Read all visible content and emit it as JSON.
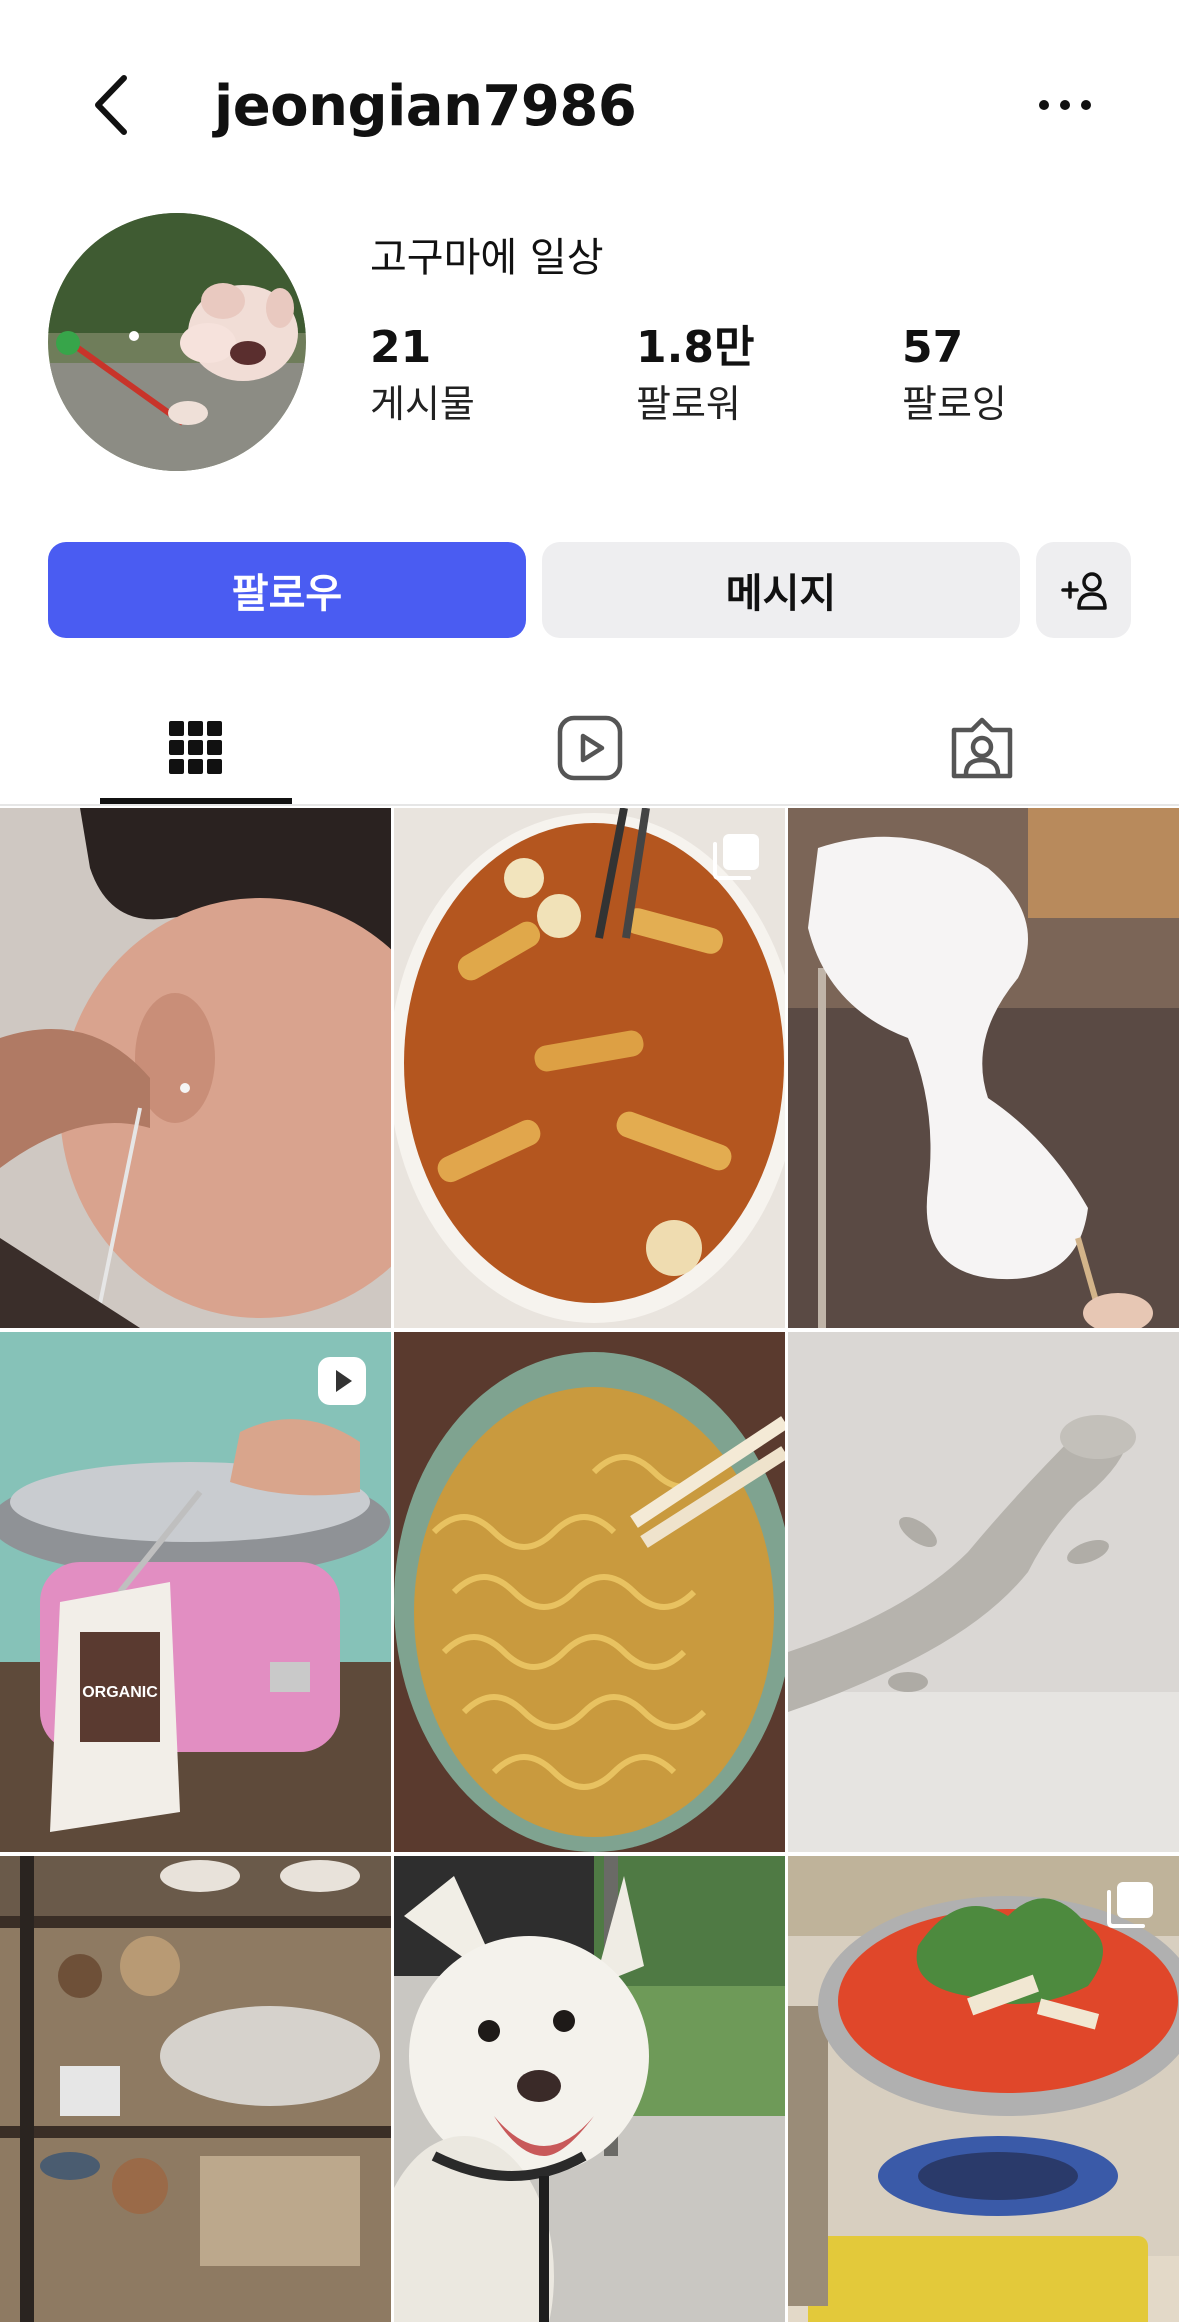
{
  "header": {
    "username": "jeongian7986"
  },
  "profile": {
    "display_name": "고구마에 일상",
    "stats": [
      {
        "value": "21",
        "label": "게시물"
      },
      {
        "value": "1.8만",
        "label": "팔로워"
      },
      {
        "value": "57",
        "label": "팔로잉"
      }
    ]
  },
  "actions": {
    "follow_label": "팔로우",
    "message_label": "메시지"
  },
  "tabs": [
    {
      "icon": "grid-icon",
      "selected": true
    },
    {
      "icon": "reels-icon",
      "selected": false
    },
    {
      "icon": "tagged-icon",
      "selected": false
    }
  ],
  "posts": [
    {
      "subject": "ear-piercing-photo",
      "badge": null
    },
    {
      "subject": "tteokbokki-photo",
      "badge": "carousel-icon"
    },
    {
      "subject": "cotton-candy-photo",
      "badge": null
    },
    {
      "subject": "cotton-candy-machine-photo",
      "badge": "reel-icon",
      "caption_text": "ORGANIC"
    },
    {
      "subject": "ramen-bowl-photo",
      "badge": null
    },
    {
      "subject": "ceramic-lizard-photo",
      "badge": null
    },
    {
      "subject": "ceramics-shop-photo",
      "badge": null
    },
    {
      "subject": "white-dog-photo",
      "badge": null
    },
    {
      "subject": "spicy-hotpot-photo",
      "badge": "carousel-icon"
    }
  ],
  "colors": {
    "follow_button": "#4a5cf2",
    "secondary_button": "#eeeef0",
    "text": "#111111"
  }
}
